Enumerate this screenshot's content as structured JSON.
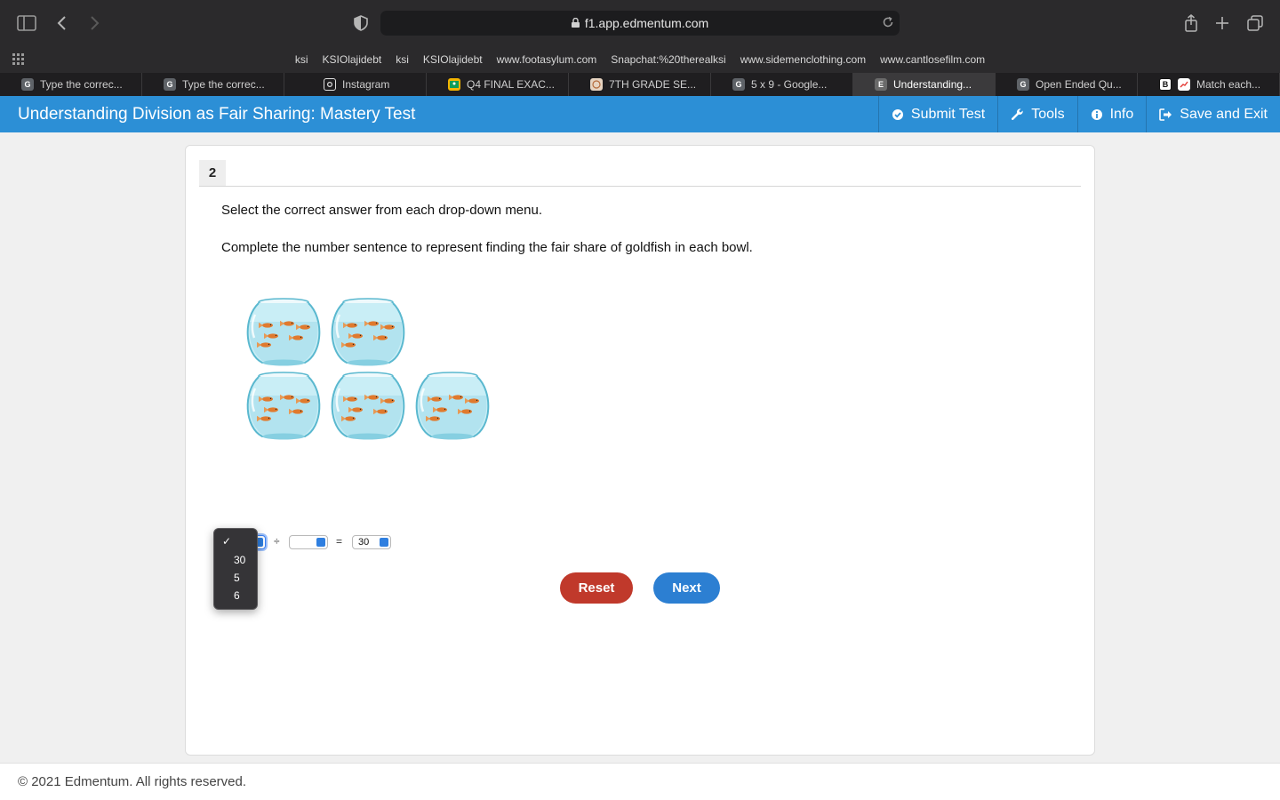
{
  "browser": {
    "url": "f1.app.edmentum.com",
    "bookmarks": [
      "ksi",
      "KSIOlajidebt",
      "ksi",
      "KSIOlajidebt",
      "www.footasylum.com",
      "Snapchat:%20therealksi",
      "www.sidemenclothing.com",
      "www.cantlosefilm.com"
    ],
    "tabs": [
      {
        "label": "Type the correc...",
        "icon": "G",
        "active": false
      },
      {
        "label": "Type the correc...",
        "icon": "G",
        "active": false
      },
      {
        "label": "Instagram",
        "icon": "instagram",
        "active": false
      },
      {
        "label": "Q4 FINAL EXAC...",
        "icon": "classroom",
        "active": false
      },
      {
        "label": "7TH GRADE SE...",
        "icon": "image",
        "active": false
      },
      {
        "label": "5 x 9 - Google...",
        "icon": "G",
        "active": false
      },
      {
        "label": "Understanding...",
        "icon": "E",
        "active": true
      },
      {
        "label": "Open Ended Qu...",
        "icon": "G",
        "active": false
      },
      {
        "label": "Match each...",
        "icon": "B",
        "active": false
      }
    ]
  },
  "app": {
    "title": "Understanding Division as Fair Sharing: Mastery Test",
    "actions": {
      "submit": "Submit Test",
      "tools": "Tools",
      "info": "Info",
      "save_exit": "Save and Exit"
    }
  },
  "question": {
    "number": "2",
    "instruction": "Select the correct answer from each drop-down menu.",
    "prompt": "Complete the number sentence to represent finding the fair share of goldfish in each bowl.",
    "sentence": {
      "divide_symbol": "÷",
      "equals_symbol": "=",
      "dropdown1_value": "",
      "dropdown2_value": "",
      "dropdown3_value": "30"
    },
    "open_dropdown": {
      "checked_marker": "✓",
      "options": [
        "30",
        "5",
        "6"
      ]
    },
    "buttons": {
      "reset": "Reset",
      "next": "Next"
    }
  },
  "footer": {
    "copyright": "© 2021 Edmentum. All rights reserved."
  },
  "colors": {
    "header_blue": "#2c8fd6",
    "reset_red": "#c0392b",
    "next_blue": "#2c7fd2",
    "water": "#bfe9f2"
  }
}
